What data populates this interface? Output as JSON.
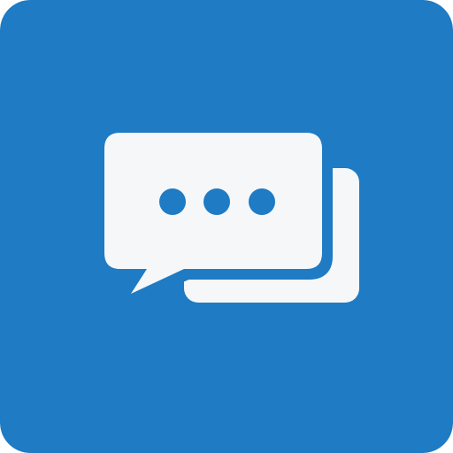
{
  "icon": {
    "name": "chat-bubbles-icon",
    "colors": {
      "background": "#1e7bc4",
      "foreground": "#f5f7f9",
      "dots": "#1e7bc4"
    }
  }
}
